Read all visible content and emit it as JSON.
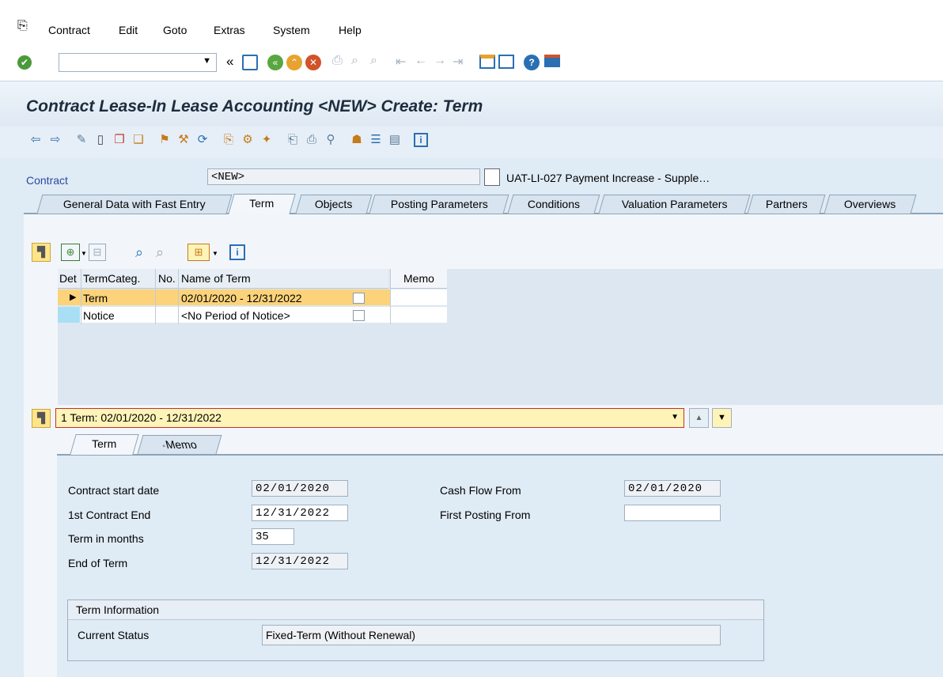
{
  "menu": {
    "items": [
      "Contract",
      "Edit",
      "Goto",
      "Extras",
      "System",
      "Help"
    ]
  },
  "title": "Contract Lease-In Lease Accounting <NEW> Create: Term",
  "contract": {
    "label": "Contract",
    "value": "<NEW>",
    "description": "UAT-LI-027 Payment Increase - Supple…"
  },
  "tabs": [
    "General Data with Fast Entry",
    "Term",
    "Objects",
    "Posting Parameters",
    "Conditions",
    "Valuation Parameters",
    "Partners",
    "Overviews"
  ],
  "active_tab": "Term",
  "table": {
    "columns": [
      "Det",
      "TermCateg.",
      "No.",
      "Name of Term",
      "Memo"
    ],
    "rows": [
      {
        "categ": "Term",
        "no": "",
        "name": "02/01/2020 - 12/31/2022"
      },
      {
        "categ": "Notice",
        "no": "",
        "name": "<No Period of Notice>"
      }
    ]
  },
  "term_selector": {
    "value": "1 Term: 02/01/2020 - 12/31/2022"
  },
  "subtabs": [
    "Term",
    "Memo"
  ],
  "form": {
    "contract_start_date": {
      "label": "Contract start date",
      "value": "02/01/2020"
    },
    "first_contract_end": {
      "label": "1st Contract End",
      "value": "12/31/2022"
    },
    "term_in_months": {
      "label": "Term in months",
      "value": "35"
    },
    "end_of_term": {
      "label": "End of Term",
      "value": "12/31/2022"
    },
    "cash_flow_from": {
      "label": "Cash Flow From",
      "value": "02/01/2020"
    },
    "first_posting_from": {
      "label": "First Posting From",
      "value": ""
    }
  },
  "term_info": {
    "title": "Term Information",
    "status_label": "Current Status",
    "status_value": "Fixed-Term (Without Renewal)"
  },
  "colors": {
    "selected_row": "#fcd37a",
    "selector_bg": "#fff4b8",
    "title_text": "#1d2d3e",
    "ok_green": "#4a9a3a"
  }
}
